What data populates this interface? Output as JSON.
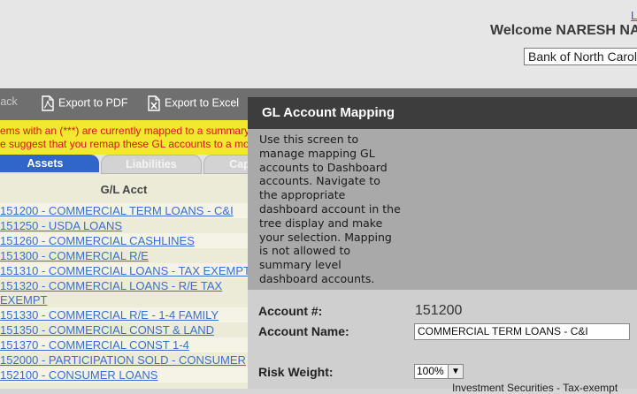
{
  "header": {
    "logout_text": "L",
    "welcome": "Welcome  NARESH NA",
    "bank": "Bank of North Carol"
  },
  "toolbar": {
    "back_label": "Back",
    "export_pdf": "Export to PDF",
    "export_excel": "Export to Excel"
  },
  "left": {
    "warning_line1": "ems with an (***) are currently mapped to a summary",
    "warning_line2": "e suggest that you remap these GL accounts to a mo",
    "tabs": [
      {
        "label": "Assets"
      },
      {
        "label": "Liabilities"
      },
      {
        "label": "Cap"
      }
    ],
    "column_header": "G/L Acct",
    "gl_accounts": [
      "151200 - COMMERCIAL TERM LOANS - C&I",
      "151250 - USDA LOANS",
      "151260 - COMMERCIAL CASHLINES",
      "151300 - COMMERCIAL R/E",
      "151310 - COMMERCIAL LOANS - TAX EXEMPT",
      "151320 - COMMERCIAL LOANS - R/E TAX EXEMPT",
      "151330 - COMMERCIAL R/E - 1-4 FAMILY",
      "151350 - COMMERCIAL CONST & LAND",
      "151370 - COMMERCIAL CONST 1-4",
      "152000 - PARTICIPATION SOLD - CONSUMER",
      "152100 - CONSUMER LOANS"
    ]
  },
  "modal": {
    "title": "GL Account Mapping",
    "description": "Use this screen to manage mapping GL accounts to Dashboard accounts. Navigate to the appropriate dashboard account in the tree display and make your selection. Mapping is not allowed to summary level dashboard accounts.",
    "account_number_label": "Account #:",
    "account_number_value": "151200",
    "account_name_label": "Account Name:",
    "account_name_value": "COMMERCIAL TERM LOANS - C&I",
    "risk_weight_label": "Risk Weight:",
    "risk_weight_value": "100%",
    "tree_node_partial": "Investment Securities - Tax-exempt"
  },
  "colors": {
    "toolbar": "#6f6f6f",
    "modal_title": "#3d3d3d",
    "active_tab": "#2f66c7",
    "warning_bg": "#f2e830",
    "warning_text": "#d81616",
    "link": "#3a6ed0"
  }
}
